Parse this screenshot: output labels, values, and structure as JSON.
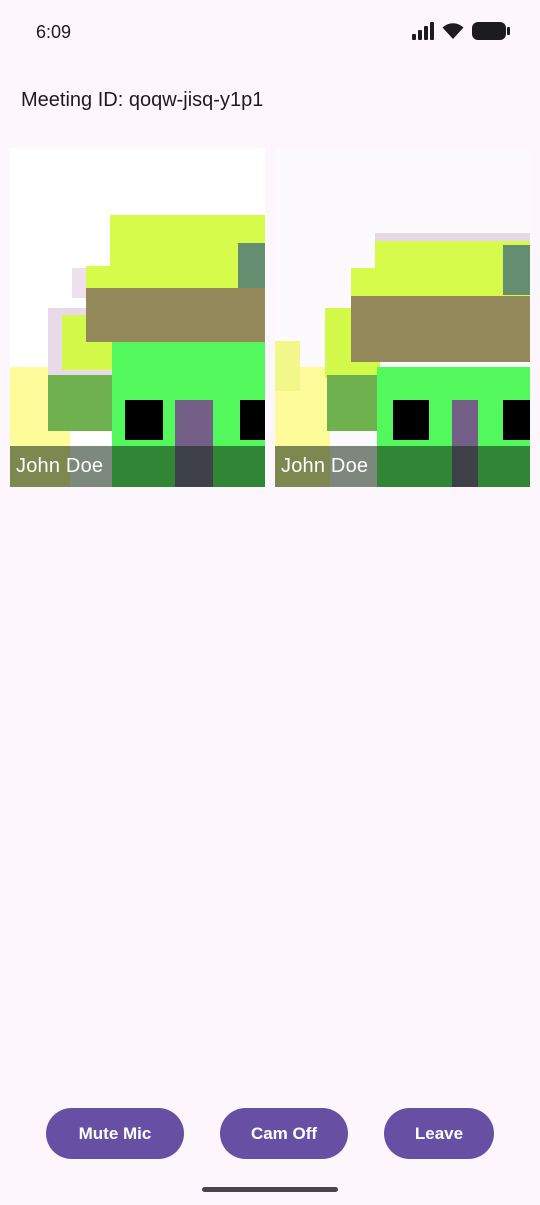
{
  "status_bar": {
    "time": "6:09",
    "icons": [
      "signal-icon",
      "wifi-icon",
      "battery-icon"
    ]
  },
  "meeting": {
    "id_label": "Meeting ID: qoqw-jisq-y1p1"
  },
  "participants": [
    {
      "name": "John Doe"
    },
    {
      "name": "John Doe"
    }
  ],
  "controls": {
    "mute_label": "Mute Mic",
    "cam_label": "Cam Off",
    "leave_label": "Leave"
  },
  "colors": {
    "accent": "#6750a4",
    "background": "#fdf6fd"
  }
}
